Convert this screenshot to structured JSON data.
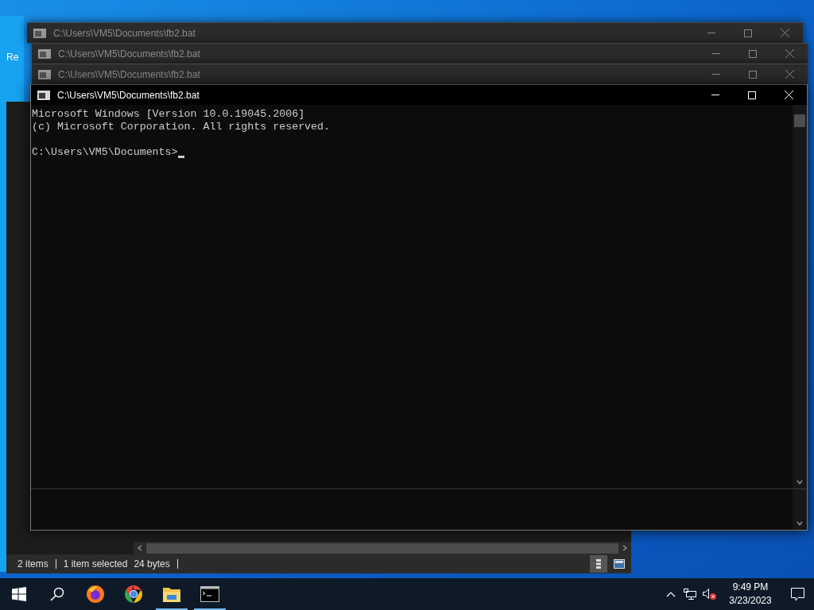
{
  "desktop": {
    "icon_labels": [
      "Re"
    ]
  },
  "explorer": {
    "status_bar": [
      "2 items",
      "1 item selected",
      "24 bytes"
    ]
  },
  "console_windows": [
    {
      "title": "C:\\Users\\VM5\\Documents\\fb2.bat",
      "active": false
    },
    {
      "title": "C:\\Users\\VM5\\Documents\\fb2.bat",
      "active": false
    },
    {
      "title": "C:\\Users\\VM5\\Documents\\fb2.bat",
      "active": false
    },
    {
      "title": "C:\\Users\\VM5\\Documents\\fb2.bat",
      "active": true,
      "lines": [
        "Microsoft Windows [Version 10.0.19045.2006]",
        "(c) Microsoft Corporation. All rights reserved."
      ],
      "prompt": "C:\\Users\\VM5\\Documents>"
    }
  ],
  "taskbar": {
    "apps": [
      {
        "kind": "start",
        "running": false
      },
      {
        "kind": "search",
        "running": false
      },
      {
        "kind": "firefox",
        "running": false
      },
      {
        "kind": "chrome",
        "running": false
      },
      {
        "kind": "explorer",
        "running": true
      },
      {
        "kind": "terminal",
        "running": true
      }
    ],
    "tray": {
      "volume_muted": true
    },
    "clock": {
      "time": "9:49 PM",
      "date": "3/23/2023"
    }
  }
}
